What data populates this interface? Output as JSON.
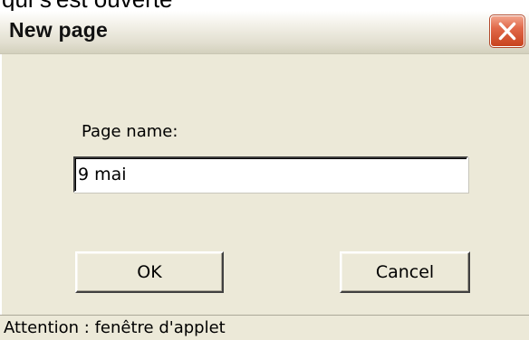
{
  "background": {
    "text": "qui s'est ouverte"
  },
  "dialog": {
    "title": "New page",
    "close_icon": "close-icon",
    "colors": {
      "face": "#ece9d8",
      "close_button": "#d9552f"
    }
  },
  "form": {
    "label": "Page name:",
    "input_value": "9 mai"
  },
  "buttons": {
    "ok_label": "OK",
    "cancel_label": "Cancel"
  },
  "status_bar": {
    "text": "Attention : fenêtre d'applet"
  }
}
